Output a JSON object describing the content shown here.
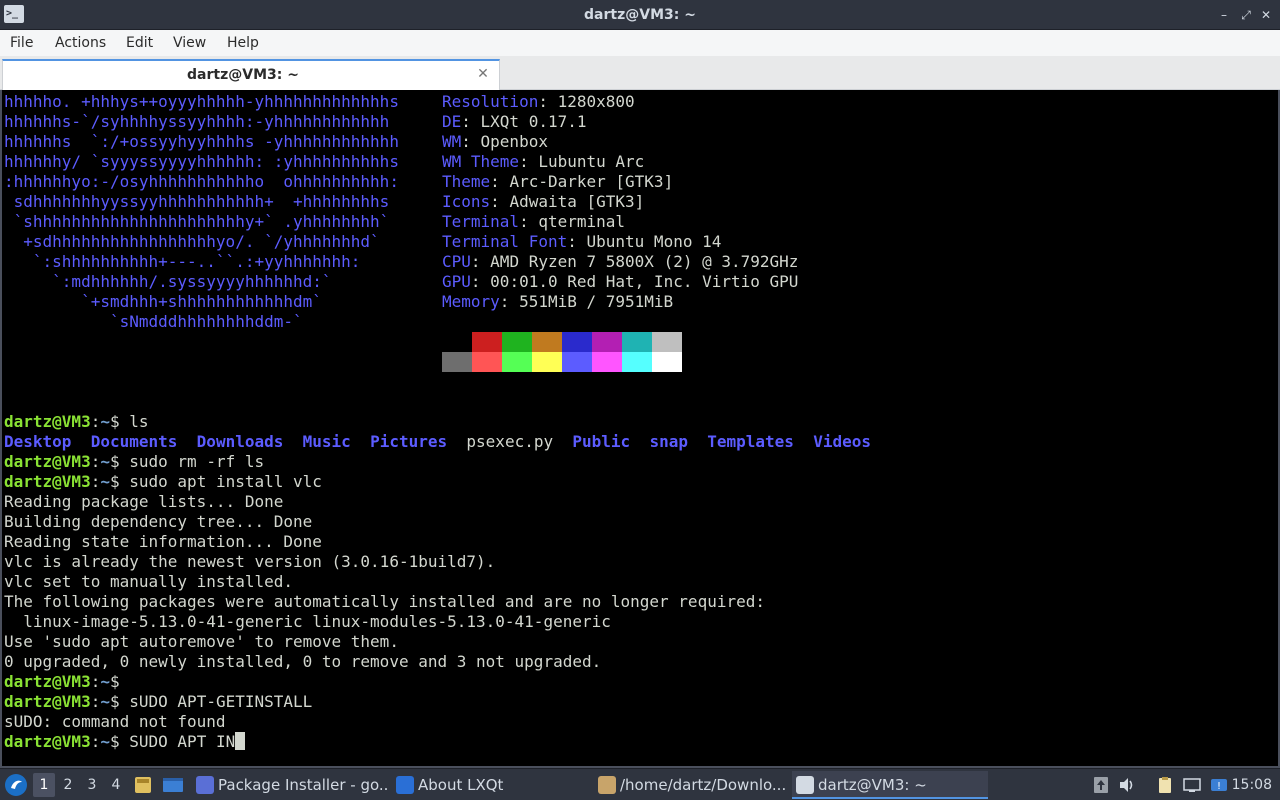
{
  "window": {
    "title": "dartz@VM3: ~",
    "app_icon_glyph": ">_",
    "controls": {
      "minimize": "–",
      "maximize": "⤢",
      "close": "✕"
    }
  },
  "menu": [
    "File",
    "Actions",
    "Edit",
    "View",
    "Help"
  ],
  "tab": {
    "label": "dartz@VM3: ~",
    "close": "✕"
  },
  "neofetch": {
    "logo": [
      "hhhhho. +hhhys++oyyyhhhhh-yhhhhhhhhhhhhhs",
      "hhhhhhs-`/syhhhhyssyyhhhh:-yhhhhhhhhhhhh",
      "hhhhhhs  `:/+ossyyhyyhhhhs -yhhhhhhhhhhhh",
      "hhhhhhy/ `syyyssyyyyhhhhhh: :yhhhhhhhhhhs",
      ":hhhhhhyo:-/osyhhhhhhhhhhho  ohhhhhhhhhh:",
      " sdhhhhhhhyyssyyhhhhhhhhhhh+  +hhhhhhhhs",
      " `shhhhhhhhhhhhhhhhhhhhhhy+` .yhhhhhhhh`",
      "  +sdhhhhhhhhhhhhhhhhhyo/. `/yhhhhhhhd`",
      "   `:shhhhhhhhhh+---..``.:+yyhhhhhhh:",
      "     `:mdhhhhhh/.syssyyyyhhhhhhd:`",
      "        `+smdhhh+shhhhhhhhhhhhdm`",
      "           `sNmdddhhhhhhhhddm-`"
    ],
    "info": [
      {
        "key": "Resolution",
        "value": "1280x800"
      },
      {
        "key": "DE",
        "value": "LXQt 0.17.1"
      },
      {
        "key": "WM",
        "value": "Openbox"
      },
      {
        "key": "WM Theme",
        "value": "Lubuntu Arc"
      },
      {
        "key": "Theme",
        "value": "Arc-Darker [GTK3]"
      },
      {
        "key": "Icons",
        "value": "Adwaita [GTK3]"
      },
      {
        "key": "Terminal",
        "value": "qterminal"
      },
      {
        "key": "Terminal Font",
        "value": "Ubuntu Mono 14"
      },
      {
        "key": "CPU",
        "value": "AMD Ryzen 7 5800X (2) @ 3.792GHz"
      },
      {
        "key": "GPU",
        "value": "00:01.0 Red Hat, Inc. Virtio GPU"
      },
      {
        "key": "Memory",
        "value": "551MiB / 7951MiB"
      }
    ],
    "palette_top": [
      "#000000",
      "#cc1f1f",
      "#1fb31f",
      "#c07a1f",
      "#2a2acc",
      "#b31fb3",
      "#1fb3b3",
      "#bfbfbf"
    ],
    "palette_bottom": [
      "#6e6e6e",
      "#ff5555",
      "#55ff55",
      "#ffff55",
      "#5c5cff",
      "#ff55ff",
      "#55ffff",
      "#ffffff"
    ]
  },
  "prompt": {
    "user": "dartz@VM3",
    "sep": ":",
    "path": "~",
    "sym": "$"
  },
  "session": [
    {
      "type": "cmd",
      "text": " ls"
    },
    {
      "type": "ls",
      "items": [
        {
          "name": "Desktop",
          "dir": true
        },
        {
          "name": "Documents",
          "dir": true
        },
        {
          "name": "Downloads",
          "dir": true
        },
        {
          "name": "Music",
          "dir": true
        },
        {
          "name": "Pictures",
          "dir": true
        },
        {
          "name": "psexec.py",
          "dir": false
        },
        {
          "name": "Public",
          "dir": true
        },
        {
          "name": "snap",
          "dir": true
        },
        {
          "name": "Templates",
          "dir": true
        },
        {
          "name": "Videos",
          "dir": true
        }
      ]
    },
    {
      "type": "cmd",
      "text": " sudo rm -rf ls"
    },
    {
      "type": "cmd",
      "text": " sudo apt install vlc"
    },
    {
      "type": "out",
      "text": "Reading package lists... Done"
    },
    {
      "type": "out",
      "text": "Building dependency tree... Done"
    },
    {
      "type": "out",
      "text": "Reading state information... Done"
    },
    {
      "type": "out",
      "text": "vlc is already the newest version (3.0.16-1build7)."
    },
    {
      "type": "out",
      "text": "vlc set to manually installed."
    },
    {
      "type": "out",
      "text": "The following packages were automatically installed and are no longer required:"
    },
    {
      "type": "out",
      "text": "  linux-image-5.13.0-41-generic linux-modules-5.13.0-41-generic"
    },
    {
      "type": "out",
      "text": "Use 'sudo apt autoremove' to remove them."
    },
    {
      "type": "out",
      "text": "0 upgraded, 0 newly installed, 0 to remove and 3 not upgraded."
    },
    {
      "type": "cmd",
      "text": ""
    },
    {
      "type": "cmd",
      "text": " sUDO APT-GETINSTALL"
    },
    {
      "type": "out",
      "text": "sUDO: command not found"
    },
    {
      "type": "cmd",
      "text": " SUDO APT IN",
      "cursor": true
    }
  ],
  "taskbar": {
    "workspaces": [
      "1",
      "2",
      "3",
      "4"
    ],
    "tasks": [
      {
        "label": "Package Installer - go...",
        "color": "#5a6fd6"
      },
      {
        "label": "About LXQt",
        "color": "#2a6fd6"
      },
      {
        "label": "/home/dartz/Downlo...",
        "color": "#c8a46a"
      },
      {
        "label": "dartz@VM3: ~",
        "color": "#d3dae3"
      }
    ],
    "clock": "15:08"
  }
}
